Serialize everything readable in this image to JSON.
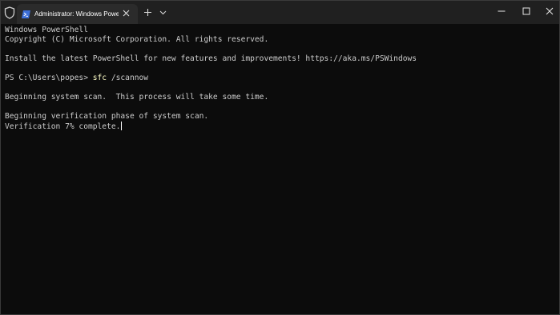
{
  "titlebar": {
    "tab_title": "Administrator: Windows PowerShell"
  },
  "terminal": {
    "lines": [
      "Windows PowerShell",
      "Copyright (C) Microsoft Corporation. All rights reserved.",
      "",
      "Install the latest PowerShell for new features and improvements! https://aka.ms/PSWindows",
      "",
      "",
      "",
      "Beginning system scan.  This process will take some time.",
      "",
      "Beginning verification phase of system scan.",
      "Verification 7% complete."
    ],
    "prompt": "PS C:\\Users\\popes> ",
    "command": "sfc",
    "command_args": " /scannow"
  },
  "colors": {
    "background": "#0c0c0c",
    "titlebar": "#202020",
    "active_tab": "#2b2b2b",
    "text": "#cccccc",
    "command": "#ffffc8"
  },
  "icons": {
    "shield": "admin-shield-icon",
    "powershell": "powershell-icon",
    "tab_close": "close-icon",
    "new_tab": "plus-icon",
    "dropdown": "chevron-down-icon",
    "minimize": "minimize-icon",
    "maximize": "maximize-icon",
    "close": "window-close-icon"
  }
}
